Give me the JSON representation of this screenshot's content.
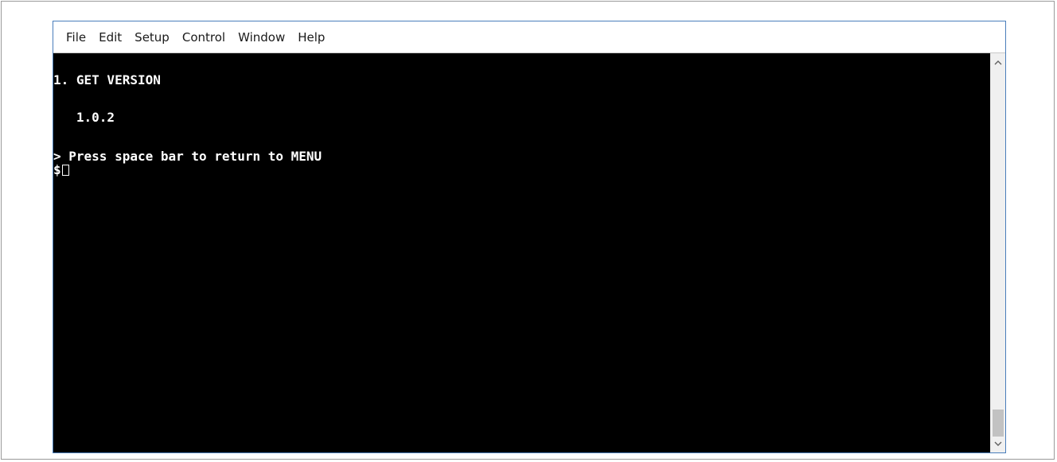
{
  "menubar": {
    "items": [
      {
        "label": "File"
      },
      {
        "label": "Edit"
      },
      {
        "label": "Setup"
      },
      {
        "label": "Control"
      },
      {
        "label": "Window"
      },
      {
        "label": "Help"
      }
    ]
  },
  "terminal": {
    "lines": [
      "1. GET VERSION",
      "   1.0.2",
      "> Press space bar to return to MENU",
      "$"
    ],
    "colors": {
      "background": "#000000",
      "text": "#ffffff"
    }
  },
  "scrollbar": {
    "up_icon": "chevron-up-icon",
    "down_icon": "chevron-down-icon"
  }
}
